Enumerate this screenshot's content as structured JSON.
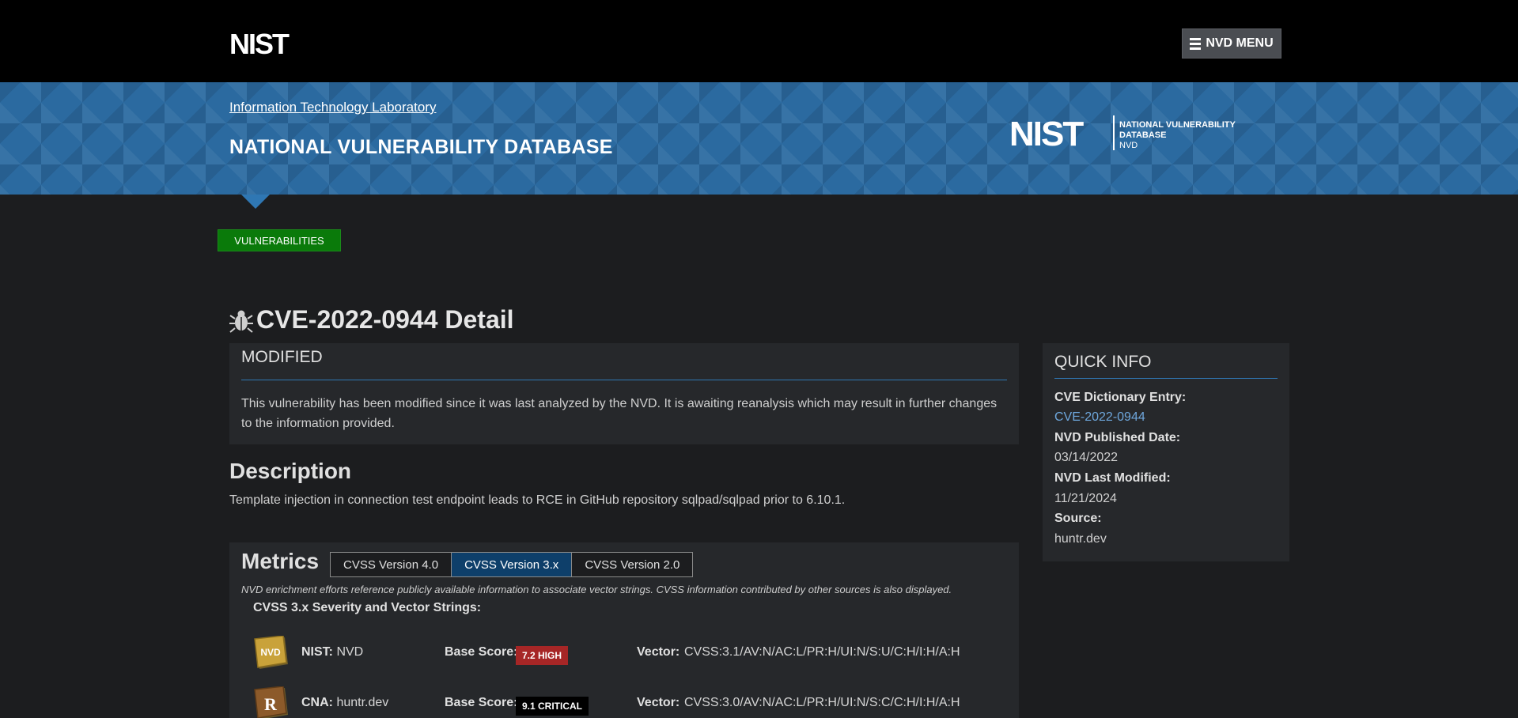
{
  "header": {
    "menu_label": "NVD MENU",
    "menu_icon": "hamburger-icon",
    "logo": "NIST"
  },
  "banner": {
    "itl_link": "Information Technology Laboratory",
    "title": "NATIONAL VULNERABILITY DATABASE",
    "logo_wordmark": "NIST",
    "logo_line1": "NATIONAL VULNERABILITY",
    "logo_line2": "DATABASE",
    "logo_line3": "NVD"
  },
  "tag": "VULNERABILITIES",
  "page": {
    "title": "CVE-2022-0944 Detail",
    "title_icon": "bug-icon"
  },
  "modified": {
    "heading": "MODIFIED",
    "text": "This vulnerability has been modified since it was last analyzed by the NVD. It is awaiting reanalysis which may result in further changes to the information provided."
  },
  "description": {
    "heading": "Description",
    "text": "Template injection in connection test endpoint leads to RCE in GitHub repository sqlpad/sqlpad prior to 6.10.1."
  },
  "metrics": {
    "heading": "Metrics",
    "tabs": [
      {
        "label": "CVSS Version 4.0",
        "active": false
      },
      {
        "label": "CVSS Version 3.x",
        "active": true
      },
      {
        "label": "CVSS Version 2.0",
        "active": false
      }
    ],
    "note": "NVD enrichment efforts reference publicly available information to associate vector strings. CVSS information contributed by other sources is also displayed.",
    "severity_heading": "CVSS 3.x Severity and Vector Strings:",
    "rows": [
      {
        "icon": "nvd-icon",
        "icon_text": "NVD",
        "source_label": "NIST:",
        "source_value": "NVD",
        "base_score_label": "Base Score:",
        "base_score": "7.2 HIGH",
        "vector_label": "Vector:",
        "vector": "CVSS:3.1/AV:N/AC:L/PR:H/UI:N/S:U/C:H/I:H/A:H"
      },
      {
        "icon": "cna-icon",
        "icon_text": "R",
        "source_label": "CNA:",
        "source_value": "huntr.dev",
        "base_score_label": "Base Score:",
        "base_score": "9.1 CRITICAL",
        "vector_label": "Vector:",
        "vector": "CVSS:3.0/AV:N/AC:L/PR:H/UI:N/S:C/C:H/I:H/A:H"
      }
    ]
  },
  "quick_info": {
    "heading": "QUICK INFO",
    "cve_entry_label": "CVE Dictionary Entry:",
    "cve_entry_value": "CVE-2022-0944",
    "published_label": "NVD Published Date:",
    "published_value": "03/14/2022",
    "modified_label": "NVD Last Modified:",
    "modified_value": "11/21/2024",
    "source_label": "Source:",
    "source_value": "huntr.dev"
  },
  "colors": {
    "accent_blue": "#2f77b3",
    "banner_blue": "#2b6aa0",
    "tag_green": "#0a7a0a",
    "high_red": "#a62626",
    "critical_black": "#000000",
    "link_blue": "#6ea7dc"
  }
}
